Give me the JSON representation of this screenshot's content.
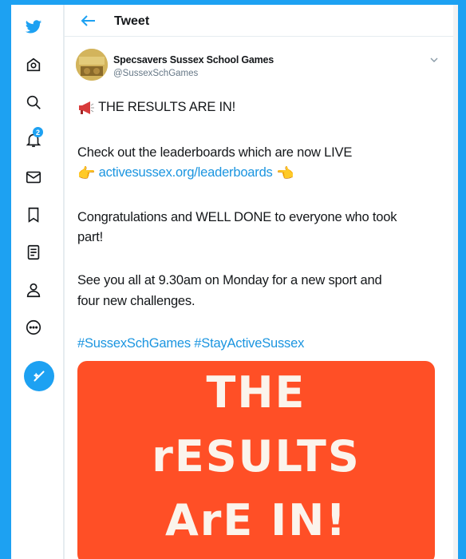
{
  "header": {
    "title": "Tweet"
  },
  "rail": {
    "icons": [
      "twitter-logo-icon",
      "home-icon",
      "explore-icon",
      "notifications-icon",
      "messages-icon",
      "bookmarks-icon",
      "lists-icon",
      "profile-icon",
      "more-icon",
      "compose-tweet-icon"
    ],
    "notification_count": "2",
    "accent": "#1da1f2"
  },
  "tweet": {
    "author_name": "Specsavers Sussex School Games",
    "author_handle": "@SussexSchGames",
    "line1": "THE RESULTS ARE IN!",
    "line2": "Check out the leaderboards which are now LIVE",
    "link": "activesussex.org/leaderboards",
    "line3a": "Congratulations and WELL DONE to everyone who took",
    "line3b": "part!",
    "line4a": "See you all at 9.30am on Monday for a new sport and",
    "line4b": "four new challenges.",
    "hashtags": "#SussexSchGames #StayActiveSussex",
    "media": {
      "line1": "THE",
      "line2": "rESULTS",
      "line3": "ArE IN!",
      "background": "#ff4f26"
    }
  }
}
